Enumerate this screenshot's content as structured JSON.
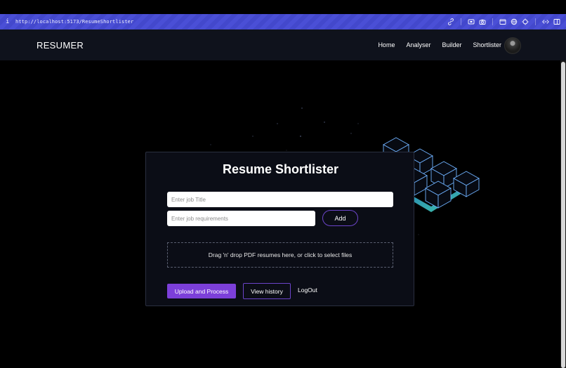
{
  "browser": {
    "info_icon": "i",
    "url": "http://localhost:5173/ResumeShortlister",
    "tools": [
      "link-icon",
      "screenshot-icon",
      "camera-icon",
      "window-icon",
      "globe-icon",
      "crosshair-icon",
      "code-icon",
      "split-view-icon"
    ]
  },
  "nav": {
    "brand": "RESUMER",
    "links": [
      "Home",
      "Analyser",
      "Builder",
      "Shortlister"
    ]
  },
  "card": {
    "title": "Resume Shortlister",
    "job_title_placeholder": "Enter job Title",
    "job_requirements_placeholder": "Enter job requirements",
    "add_label": "Add",
    "dropzone_text": "Drag 'n' drop PDF resumes here, or click to select files",
    "upload_label": "Upload and Process",
    "history_label": "View history",
    "logout_label": "LogOut"
  },
  "colors": {
    "accent": "#7c3fd9",
    "address_bar": "#4a4fd6",
    "nav_bg": "#0f121c",
    "cube_glow": "#3ee6c8"
  }
}
